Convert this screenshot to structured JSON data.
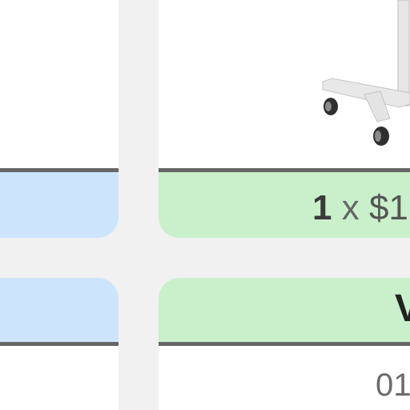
{
  "cart": {
    "item": {
      "quantity": "1",
      "times_symbol": "x",
      "price": "$1",
      "title_start": "V",
      "date": "01"
    },
    "product_image": {
      "icon": "mobile-standing-desk-image"
    }
  },
  "colors": {
    "background": "#f1f1f1",
    "card": "#ffffff",
    "blue_tile": "#cce5fd",
    "green_tile": "#c9f0cb",
    "divider": "#666666"
  }
}
